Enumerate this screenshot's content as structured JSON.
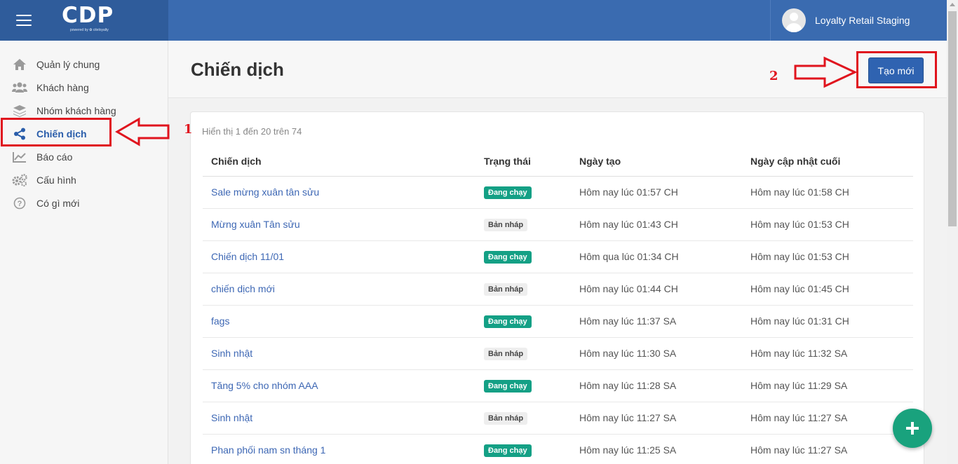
{
  "app": {
    "logo_text": "CDP",
    "logo_sub": "powered by ✿ citeloyalty",
    "user_name": "Loyalty Retail Staging"
  },
  "sidebar": {
    "items": [
      {
        "label": "Quản lý chung",
        "icon": "home-icon"
      },
      {
        "label": "Khách hàng",
        "icon": "users-icon"
      },
      {
        "label": "Nhóm khách hàng",
        "icon": "layers-icon"
      },
      {
        "label": "Chiến dịch",
        "icon": "share-icon",
        "active": true
      },
      {
        "label": "Báo cáo",
        "icon": "chart-icon"
      },
      {
        "label": "Cấu hình",
        "icon": "gears-icon"
      },
      {
        "label": "Có gì mới",
        "icon": "question-icon"
      }
    ]
  },
  "page": {
    "title": "Chiến dịch",
    "create_label": "Tạo mới",
    "count_text": "Hiển thị 1 đến 20 trên 74"
  },
  "table": {
    "headers": [
      "Chiến dịch",
      "Trạng thái",
      "Ngày tạo",
      "Ngày cập nhật cuối"
    ],
    "rows": [
      {
        "name": "Sale mừng xuân tân sửu",
        "status": "Đang chạy",
        "created": "Hôm nay lúc 01:57 CH",
        "updated": "Hôm nay lúc 01:58 CH"
      },
      {
        "name": "Mừng xuân Tân sửu",
        "status": "Bản nháp",
        "created": "Hôm nay lúc 01:43 CH",
        "updated": "Hôm nay lúc 01:53 CH"
      },
      {
        "name": "Chiến dịch 11/01",
        "status": "Đang chạy",
        "created": "Hôm qua lúc 01:34 CH",
        "updated": "Hôm nay lúc 01:53 CH"
      },
      {
        "name": "chiến dịch mới",
        "status": "Bản nháp",
        "created": "Hôm nay lúc 01:44 CH",
        "updated": "Hôm nay lúc 01:45 CH"
      },
      {
        "name": "fags",
        "status": "Đang chạy",
        "created": "Hôm nay lúc 11:37 SA",
        "updated": "Hôm nay lúc 01:31 CH"
      },
      {
        "name": "Sinh nhật",
        "status": "Bản nháp",
        "created": "Hôm nay lúc 11:30 SA",
        "updated": "Hôm nay lúc 11:32 SA"
      },
      {
        "name": "Tăng 5% cho nhóm AAA",
        "status": "Đang chạy",
        "created": "Hôm nay lúc 11:28 SA",
        "updated": "Hôm nay lúc 11:29 SA"
      },
      {
        "name": "Sinh nhật",
        "status": "Bản nháp",
        "created": "Hôm nay lúc 11:27 SA",
        "updated": "Hôm nay lúc 11:27 SA"
      },
      {
        "name": "Phan phối nam sn tháng 1",
        "status": "Đang chạy",
        "created": "Hôm nay lúc 11:25 SA",
        "updated": "Hôm nay lúc 11:27 SA"
      }
    ]
  },
  "annotations": {
    "label_1": "1",
    "label_2": "2",
    "color": "#e0141e"
  },
  "colors": {
    "topbar": "#3a6bb0",
    "brand": "#2f5c9b",
    "primary_button": "#2f63b1",
    "running_badge": "#14a085",
    "fab": "#19a27d"
  }
}
